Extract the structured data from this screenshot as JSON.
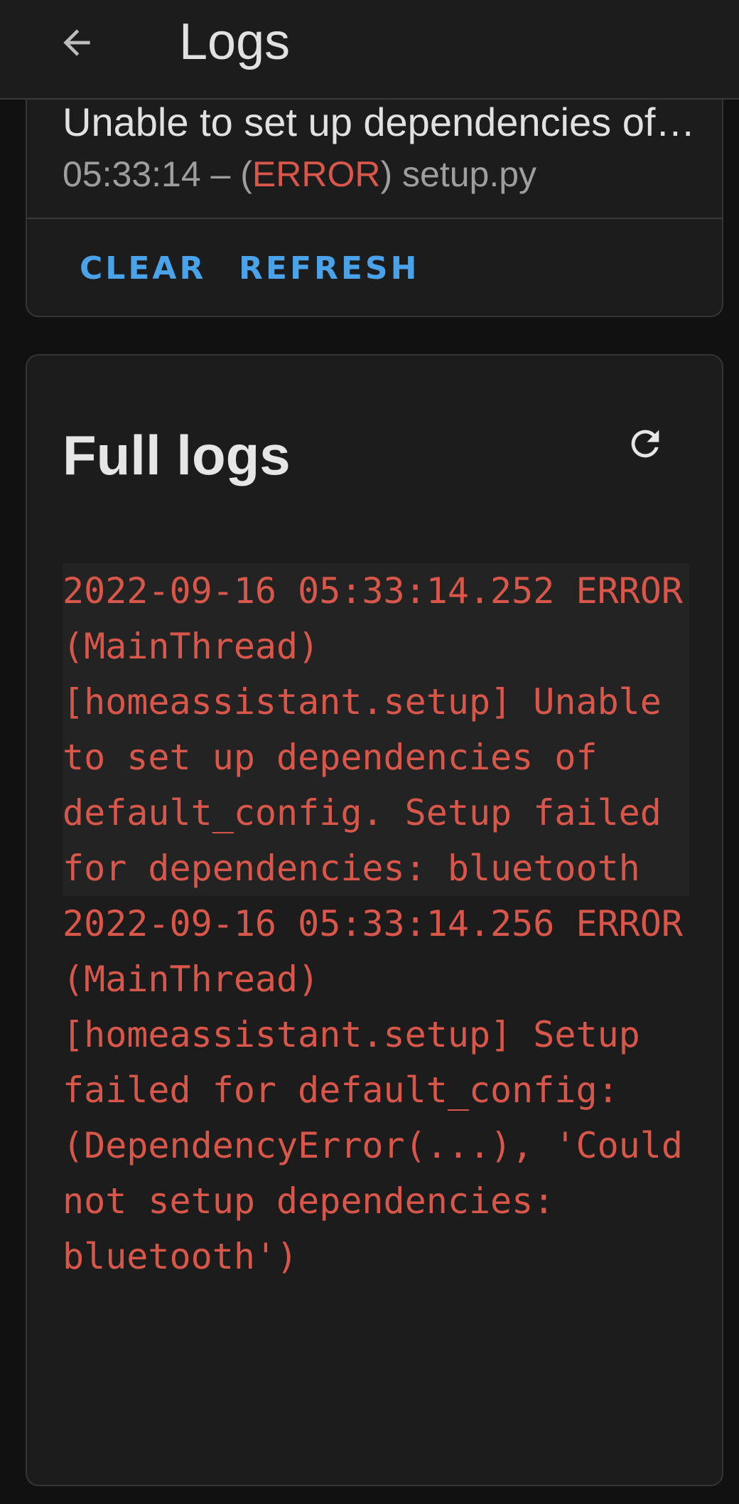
{
  "header": {
    "title": "Logs",
    "back_icon": "arrow-left-icon"
  },
  "summary": {
    "message": "Unable to set up dependencies of default_config. Setup failed for dependencies: bluetooth",
    "time": "05:33:14",
    "separator": " – (",
    "level": "ERROR",
    "source_suffix": ") setup.py",
    "actions": {
      "clear_label": "CLEAR",
      "refresh_label": "REFRESH"
    }
  },
  "full_logs": {
    "title": "Full logs",
    "refresh_icon": "refresh-icon",
    "entries": [
      "2022-09-16 05:33:14.252 ERROR (MainThread) [homeassistant.setup] Unable to set up dependencies of default_config. Setup failed for dependencies: bluetooth",
      "2022-09-16 05:33:14.256 ERROR (MainThread) [homeassistant.setup] Setup failed for default_config: (DependencyError(...), 'Could not setup dependencies: bluetooth')"
    ]
  },
  "colors": {
    "background": "#111111",
    "card": "#1c1c1c",
    "accent": "#4aa3e8",
    "error": "#d9574a",
    "text": "#e1e1e1",
    "secondary_text": "#9e9e9e"
  }
}
